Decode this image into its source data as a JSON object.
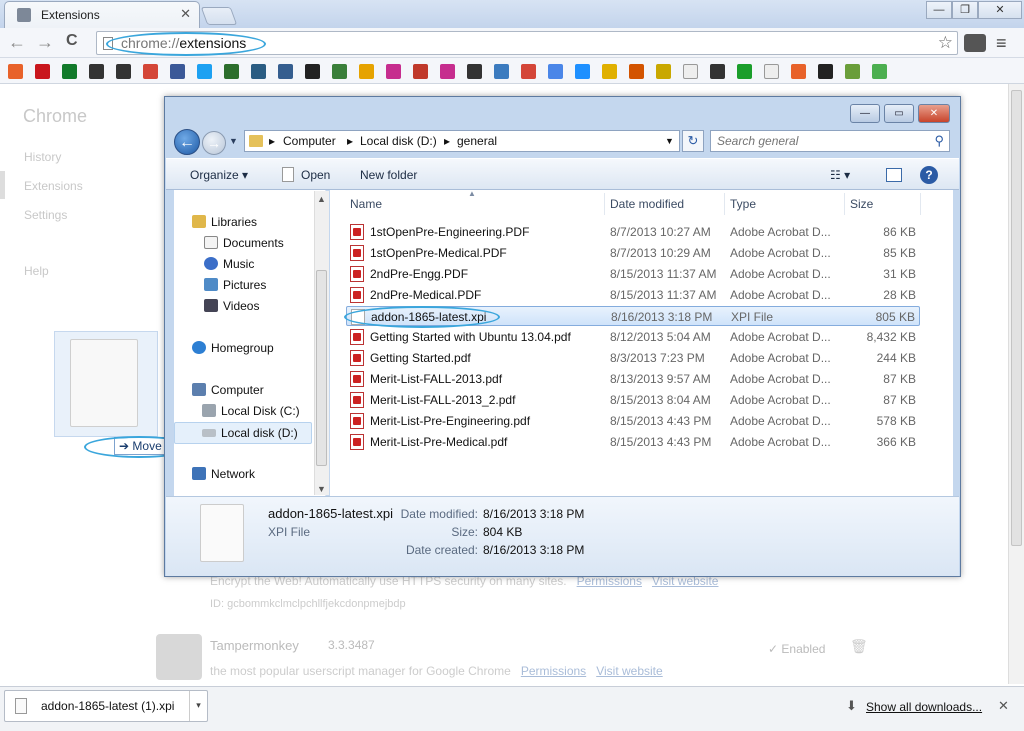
{
  "browser": {
    "tab_title": "Extensions",
    "tab_close": "✕",
    "window_min": "—",
    "window_max": "❐",
    "window_close": "✕",
    "back": "←",
    "forward": "→",
    "reload": "C",
    "url_scheme": "chrome://",
    "url_path": "extensions",
    "bookmark_star": "☆",
    "menu": "≡",
    "bookmark_colors": [
      "#e8622a",
      "#c9161d",
      "#127a2b",
      "#333333",
      "#333333",
      "#d44638",
      "#3b5998",
      "#1da1f2",
      "#2c6e2c",
      "#2a5c82",
      "#355e8f",
      "#222222",
      "#3a7f3a",
      "#e6a300",
      "#c62d8e",
      "#c0392b",
      "#c62d8e",
      "#333333",
      "#3b7bbf",
      "#d44638",
      "#4a86e8",
      "#1e90ff",
      "#e0b000",
      "#d35400",
      "#c9a800",
      "#eeeeee",
      "#333333",
      "#1b9e2b",
      "#eeeeee",
      "#e8622a",
      "#222222",
      "#6a9e3a",
      "#4caf50"
    ]
  },
  "chrome_page": {
    "title": "Chrome",
    "nav": [
      "History",
      "Extensions",
      "Settings",
      "Help"
    ],
    "ext1_desc": "Encrypt the Web! Automatically use HTTPS security on many sites.",
    "ext1_id": "ID: gcbommkclmclpchllfjekcdonpmejbdp",
    "ext2_name": "Tampermonkey",
    "ext2_version": "3.3.3487",
    "ext2_desc": "the most popular userscript manager for Google Chrome",
    "permissions": "Permissions",
    "visit_website": "Visit website",
    "enabled_label": "Enabled",
    "enabled_check": "✓"
  },
  "drag": {
    "move_label": "Move",
    "move_arrow": "➔"
  },
  "explorer": {
    "min": "—",
    "max": "▭",
    "close": "✕",
    "path": [
      "Computer",
      "Local disk (D:)",
      "general"
    ],
    "sep": "▸",
    "search_placeholder": "Search general",
    "commands": {
      "organize": "Organize ▾",
      "open": "Open",
      "new_folder": "New folder",
      "view": "☷ ▾",
      "help": "?"
    },
    "nav": {
      "libraries": "Libraries",
      "documents": "Documents",
      "music": "Music",
      "pictures": "Pictures",
      "videos": "Videos",
      "homegroup": "Homegroup",
      "computer": "Computer",
      "local_c": "Local Disk (C:)",
      "local_d": "Local disk (D:)",
      "network": "Network"
    },
    "columns": {
      "name": "Name",
      "date": "Date modified",
      "type": "Type",
      "size": "Size"
    },
    "files": [
      {
        "name": "1stOpenPre-Engineering.PDF",
        "date": "8/7/2013 10:27 AM",
        "type": "Adobe Acrobat D...",
        "size": "86 KB",
        "pdf": true
      },
      {
        "name": "1stOpenPre-Medical.PDF",
        "date": "8/7/2013 10:29 AM",
        "type": "Adobe Acrobat D...",
        "size": "85 KB",
        "pdf": true
      },
      {
        "name": "2ndPre-Engg.PDF",
        "date": "8/15/2013 11:37 AM",
        "type": "Adobe Acrobat D...",
        "size": "31 KB",
        "pdf": true
      },
      {
        "name": "2ndPre-Medical.PDF",
        "date": "8/15/2013 11:37 AM",
        "type": "Adobe Acrobat D...",
        "size": "28 KB",
        "pdf": true
      },
      {
        "name": "addon-1865-latest.xpi",
        "date": "8/16/2013 3:18 PM",
        "type": "XPI File",
        "size": "805 KB",
        "pdf": false,
        "selected": true
      },
      {
        "name": "Getting Started with Ubuntu 13.04.pdf",
        "date": "8/12/2013 5:04 AM",
        "type": "Adobe Acrobat D...",
        "size": "8,432 KB",
        "pdf": true
      },
      {
        "name": "Getting Started.pdf",
        "date": "8/3/2013 7:23 PM",
        "type": "Adobe Acrobat D...",
        "size": "244 KB",
        "pdf": true
      },
      {
        "name": "Merit-List-FALL-2013.pdf",
        "date": "8/13/2013 9:57 AM",
        "type": "Adobe Acrobat D...",
        "size": "87 KB",
        "pdf": true
      },
      {
        "name": "Merit-List-FALL-2013_2.pdf",
        "date": "8/15/2013 8:04 AM",
        "type": "Adobe Acrobat D...",
        "size": "87 KB",
        "pdf": true
      },
      {
        "name": "Merit-List-Pre-Engineering.pdf",
        "date": "8/15/2013 4:43 PM",
        "type": "Adobe Acrobat D...",
        "size": "578 KB",
        "pdf": true
      },
      {
        "name": "Merit-List-Pre-Medical.pdf",
        "date": "8/15/2013 4:43 PM",
        "type": "Adobe Acrobat D...",
        "size": "366 KB",
        "pdf": true
      }
    ],
    "details": {
      "name": "addon-1865-latest.xpi",
      "type": "XPI File",
      "date_modified_label": "Date modified:",
      "date_modified": "8/16/2013 3:18 PM",
      "size_label": "Size:",
      "size": "804 KB",
      "date_created_label": "Date created:",
      "date_created": "8/16/2013 3:18 PM"
    }
  },
  "downloads": {
    "item_name": "addon-1865-latest (1).xpi",
    "dropdown": "▾",
    "show_all": "Show all downloads...",
    "show_all_icon": "⬇",
    "close": "✕"
  }
}
